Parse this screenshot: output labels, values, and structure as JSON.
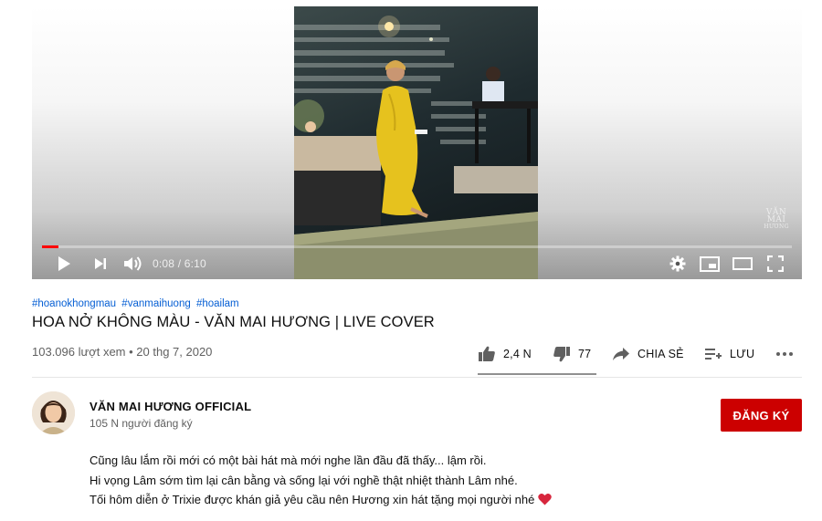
{
  "player": {
    "time_display": "0:08 / 6:10",
    "current_time": "0:08",
    "duration": "6:10",
    "progress_fraction": 0.022,
    "watermark_line1": "VĂN",
    "watermark_line2": "MAI",
    "watermark_line3": "HƯƠNG",
    "colors": {
      "progress": "#ff0000",
      "dress": "#e6c21e"
    },
    "icons": [
      "play-icon",
      "next-icon",
      "volume-icon",
      "settings-icon",
      "miniplayer-icon",
      "theater-icon",
      "fullscreen-icon"
    ]
  },
  "video": {
    "hashtags": [
      "#hoanokhongmau",
      "#vanmaihuong",
      "#hoailam"
    ],
    "title": "HOA NỞ KHÔNG MÀU - VĂN MAI HƯƠNG | LIVE COVER",
    "view_info": "103.096 lượt xem • 20 thg 7, 2020"
  },
  "actions": {
    "like_count": "2,4 N",
    "dislike_count": "77",
    "share_label": "CHIA SẺ",
    "save_label": "LƯU",
    "like_ratio": 0.97
  },
  "channel": {
    "name": "VĂN MAI HƯƠNG OFFICIAL",
    "subscribers": "105 N người đăng ký",
    "subscribe_label": "ĐĂNG KÝ",
    "subscribe_color": "#cc0000"
  },
  "description": {
    "line1": "Cũng lâu lắm rồi mới có một bài hát mà mới nghe lần đầu đã thấy... lậm rồi.",
    "line2": "Hi vọng Lâm sớm tìm lại cân bằng và sống lại với nghề thật nhiệt thành Lâm nhé.",
    "line3": "Tối hôm diễn ở Trixie được khán giả yêu cầu nên Hương xin hát tặng mọi người nhé"
  }
}
